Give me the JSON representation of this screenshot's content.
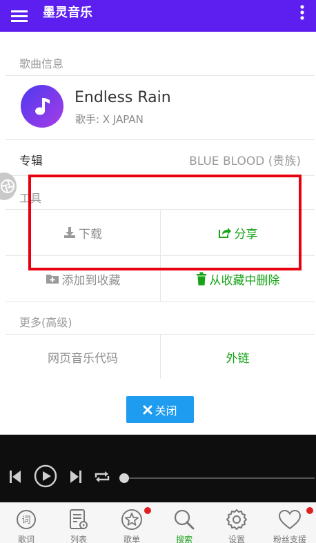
{
  "appbar": {
    "title": "墨灵音乐"
  },
  "dialog": {
    "song_section_title": "歌曲信息",
    "song": {
      "title": "Endless Rain",
      "artist_line": "歌手: X JAPAN"
    },
    "album": {
      "label": "专辑",
      "value": "BLUE BLOOD (贵族)"
    },
    "tools_section_title": "工具",
    "tools": {
      "download": "下载",
      "share": "分享",
      "add_favorite": "添加到收藏",
      "remove_favorite": "从收藏中删除"
    },
    "more_section_title": "更多(高级)",
    "more": {
      "web_code": "网页音乐代码",
      "external_link": "外链"
    },
    "close_label": "关闭"
  },
  "player": {
    "progress": 0.0
  },
  "tabbar": {
    "tabs": [
      {
        "label": "歌词",
        "icon": "lyrics-icon"
      },
      {
        "label": "列表",
        "icon": "list-icon"
      },
      {
        "label": "歌单",
        "icon": "star-icon"
      },
      {
        "label": "搜索",
        "icon": "search-icon"
      },
      {
        "label": "设置",
        "icon": "gear-icon"
      },
      {
        "label": "粉丝支援",
        "icon": "heart-icon"
      }
    ],
    "active_index": 3
  },
  "colors": {
    "appbar": "#5c1ff0",
    "accent_green": "#16a316",
    "close_button": "#1e9cf0",
    "highlight": "#e8000e"
  }
}
